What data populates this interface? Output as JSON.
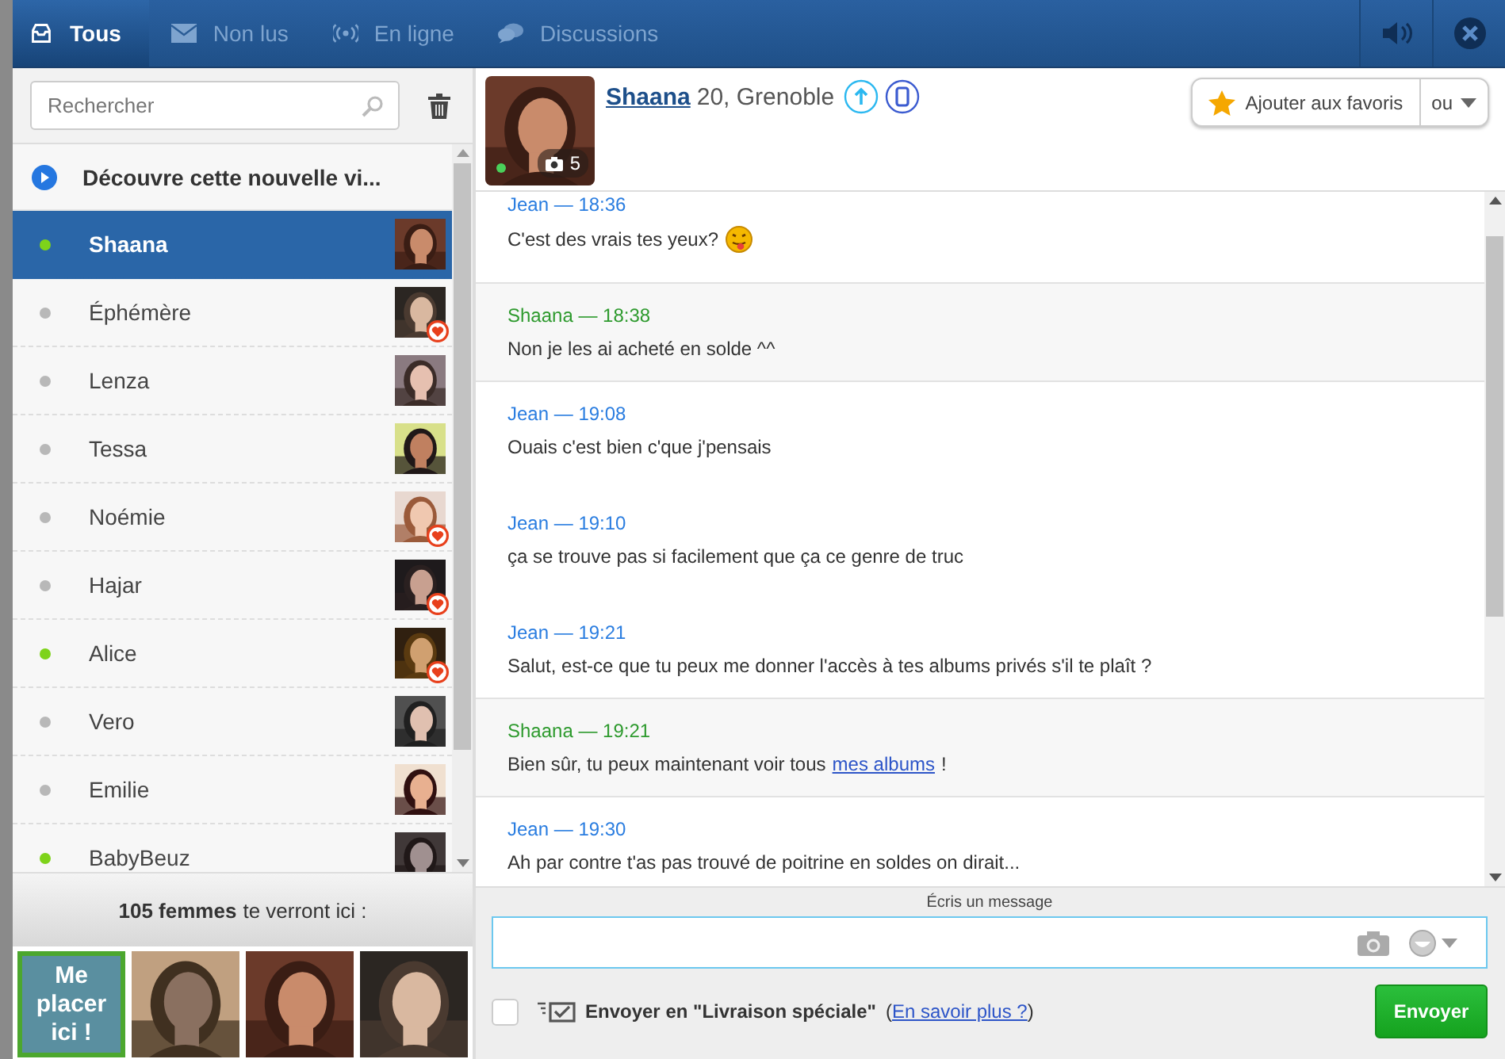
{
  "tabs": [
    {
      "label": "Tous",
      "selected": true
    },
    {
      "label": "Non lus",
      "selected": false
    },
    {
      "label": "En ligne",
      "selected": false
    },
    {
      "label": "Discussions",
      "selected": false
    }
  ],
  "search": {
    "placeholder": "Rechercher"
  },
  "promo": {
    "label": "Découvre cette nouvelle vi..."
  },
  "contacts": [
    {
      "name": "Shaana",
      "online": true,
      "selected": true,
      "favorite": false
    },
    {
      "name": "Éphémère",
      "online": false,
      "selected": false,
      "favorite": true
    },
    {
      "name": "Lenza",
      "online": false,
      "selected": false,
      "favorite": false
    },
    {
      "name": "Tessa",
      "online": false,
      "selected": false,
      "favorite": false
    },
    {
      "name": "Noémie",
      "online": false,
      "selected": false,
      "favorite": true
    },
    {
      "name": "Hajar",
      "online": false,
      "selected": false,
      "favorite": true
    },
    {
      "name": "Alice",
      "online": true,
      "selected": false,
      "favorite": true
    },
    {
      "name": "Vero",
      "online": false,
      "selected": false,
      "favorite": false
    },
    {
      "name": "Emilie",
      "online": false,
      "selected": false,
      "favorite": false
    },
    {
      "name": "BabyBeuz",
      "online": true,
      "selected": false,
      "favorite": false
    }
  ],
  "visibility": {
    "count": "105 femmes",
    "text": "te verront ici :"
  },
  "placement": {
    "label": "Me placer ici !"
  },
  "profile": {
    "name": "Shaana",
    "details": "20, Grenoble",
    "photo_count": "5",
    "online": true
  },
  "favorite_button": {
    "label": "Ajouter aux favoris"
  },
  "or_menu": {
    "label": "ou"
  },
  "groups": [
    {
      "kind": "jean",
      "messages": [
        {
          "header": "Jean — 18:36",
          "text": "C'est des vrais tes yeux?",
          "emoji": true
        }
      ]
    },
    {
      "kind": "shaana",
      "messages": [
        {
          "header": "Shaana — 18:38",
          "text": "Non je les ai acheté en solde ^^"
        }
      ]
    },
    {
      "kind": "jean",
      "messages": [
        {
          "header": "Jean — 19:08",
          "text": "Ouais c'est bien c'que j'pensais"
        },
        {
          "header": "Jean — 19:10",
          "text": "ça se trouve pas si facilement que ça ce genre de truc"
        },
        {
          "header": "Jean — 19:21",
          "text": "Salut, est-ce que tu peux me donner l'accès à tes albums privés s'il te plaît ?"
        }
      ]
    },
    {
      "kind": "shaana",
      "messages": [
        {
          "header": "Shaana — 19:21",
          "text": "Bien sûr, tu peux maintenant voir tous",
          "link": "mes albums",
          "after": "!"
        }
      ]
    },
    {
      "kind": "jean",
      "messages": [
        {
          "header": "Jean — 19:30",
          "text": "Ah par contre t'as pas trouvé de poitrine en soldes on dirait..."
        }
      ]
    }
  ],
  "compose": {
    "caption": "Écris un message",
    "special_checked": false,
    "special_label": "Envoyer en \"Livraison spéciale\"",
    "paren_open": "(",
    "learn_more": "En savoir plus ?",
    "paren_close": ")",
    "send": "Envoyer"
  }
}
